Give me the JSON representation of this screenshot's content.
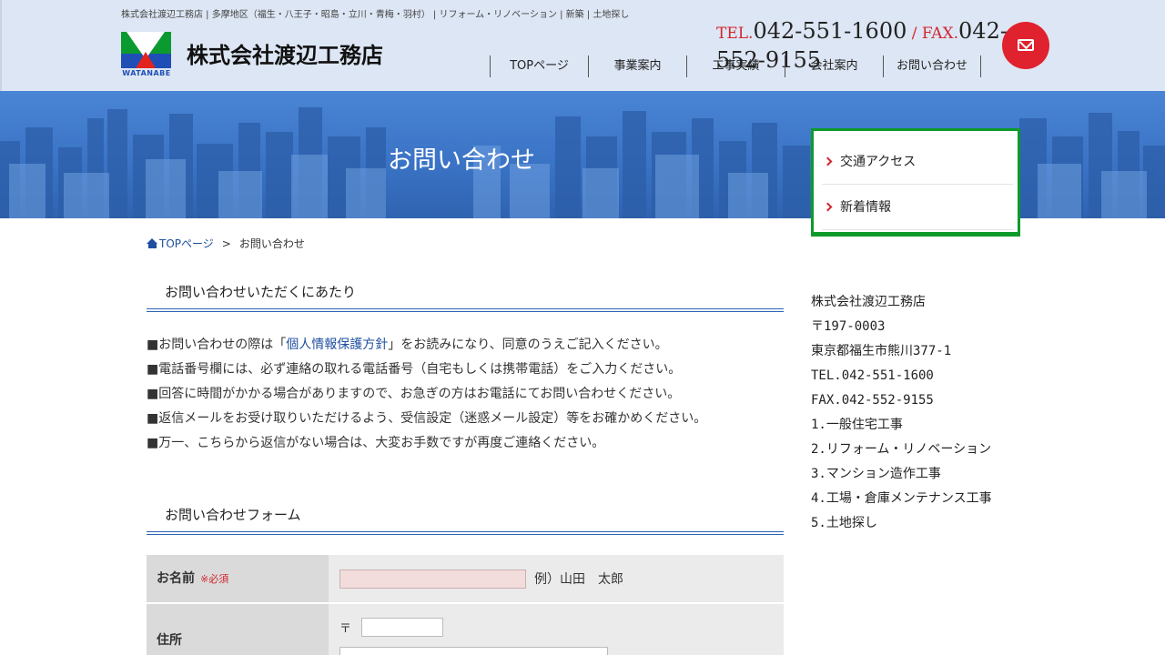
{
  "header": {
    "tagline": "株式会社渡辺工務店 | 多摩地区（福生・八王子・昭島・立川・青梅・羽村） | リフォーム・リノベーション | 新築 | 土地探し",
    "logo_text": "WATANABE",
    "company_name": "株式会社渡辺工務店",
    "tel_label": "TEL.",
    "tel_number": "042-551-1600",
    "separator": " / ",
    "fax_label": "FAX.",
    "fax_number": "042-552-9155",
    "mail_icon": "envelope-icon",
    "nav": [
      "TOPページ",
      "事業案内",
      "工事実績",
      "会社案内",
      "お問い合わせ"
    ]
  },
  "hero": {
    "title": "お問い合わせ"
  },
  "side_menu": {
    "items": [
      "交通アクセス",
      "新着情報"
    ]
  },
  "breadcrumb": {
    "home": "TOPページ",
    "separator": ">",
    "current": "お問い合わせ"
  },
  "main": {
    "section1_title": "お問い合わせいただくにあたり",
    "notes": {
      "line1_before": "■お問い合わせの際は「",
      "line1_link": "個人情報保護方針",
      "line1_after": "」をお読みになり、同意のうえご記入ください。",
      "line2": "■電話番号欄には、必ず連絡の取れる電話番号（自宅もしくは携帯電話）をご入力ください。",
      "line3": "■回答に時間がかかる場合がありますので、お急ぎの方はお電話にてお問い合わせください。",
      "line4": "■返信メールをお受け取りいただけるよう、受信設定（迷惑メール設定）等をお確かめください。",
      "line5": "■万一、こちらから返信がない場合は、大変お手数ですが再度ご連絡ください。"
    },
    "section2_title": "お問い合わせフォーム",
    "form": {
      "name_label": "お名前",
      "required_mark": "※必須",
      "name_value": "",
      "name_example": "例）山田　太郎",
      "address_label": "住所",
      "zip_mark": "〒",
      "zip_value": "",
      "address_value": ""
    }
  },
  "sidebar_info": {
    "company": "株式会社渡辺工務店",
    "zip": "〒197-0003",
    "address": "東京都福生市熊川377-1",
    "tel": "TEL.042-551-1600",
    "fax": "FAX.042-552-9155",
    "services": [
      "1.一般住宅工事",
      "2.リフォーム・リノベーション",
      "3.マンション造作工事",
      "4.工場・倉庫メンテナンス工事",
      "5.土地探し"
    ]
  },
  "colors": {
    "header_bg": "#dde6f4",
    "accent_red": "#e0212e",
    "accent_green": "#0e9a2a",
    "accent_blue": "#2a64b5"
  }
}
